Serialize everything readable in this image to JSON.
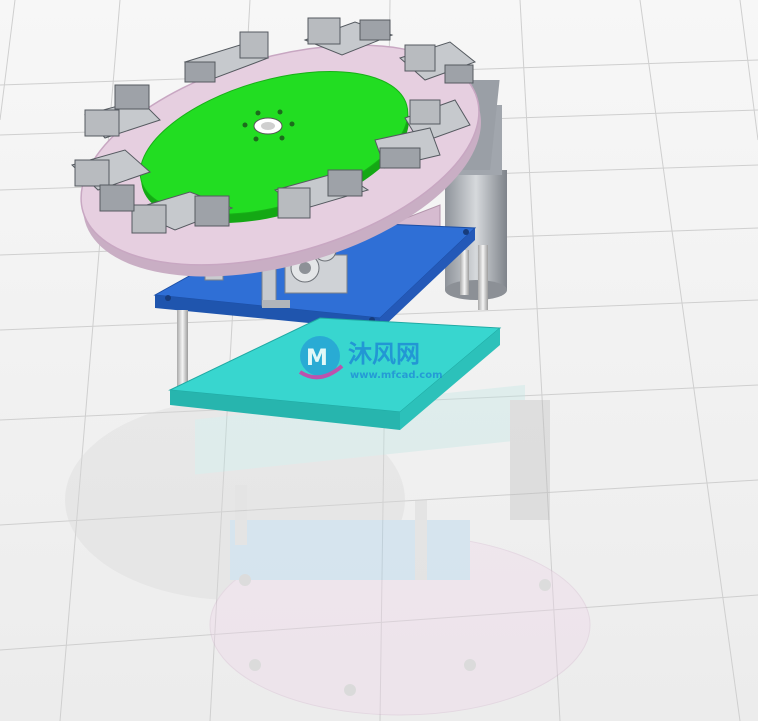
{
  "watermark": {
    "brand": "沐风网",
    "url": "www.mfcad.com"
  },
  "colors": {
    "background": "#f4f4f4",
    "grid_line": "#c9c9c9",
    "rotary_plate": "#e6cfe0",
    "rotary_plate_edge": "#c8a7c2",
    "turntable_top": "#22dd22",
    "turntable_edge": "#14a814",
    "fixture_gray": "#b9bcc0",
    "fixture_dark": "#8c9096",
    "top_mount_plate": "#2f6fd6",
    "middle_plate": "#38d6cf",
    "gearbox_body": "#e2c8dc",
    "motor_cylinder": "#a8adb4",
    "support_rod": "#dcdcdc",
    "watermark_blue": "#1a7ad8",
    "watermark_magenta": "#d43ca8"
  },
  "icons": {
    "logo": "mfcad-logo-icon"
  }
}
